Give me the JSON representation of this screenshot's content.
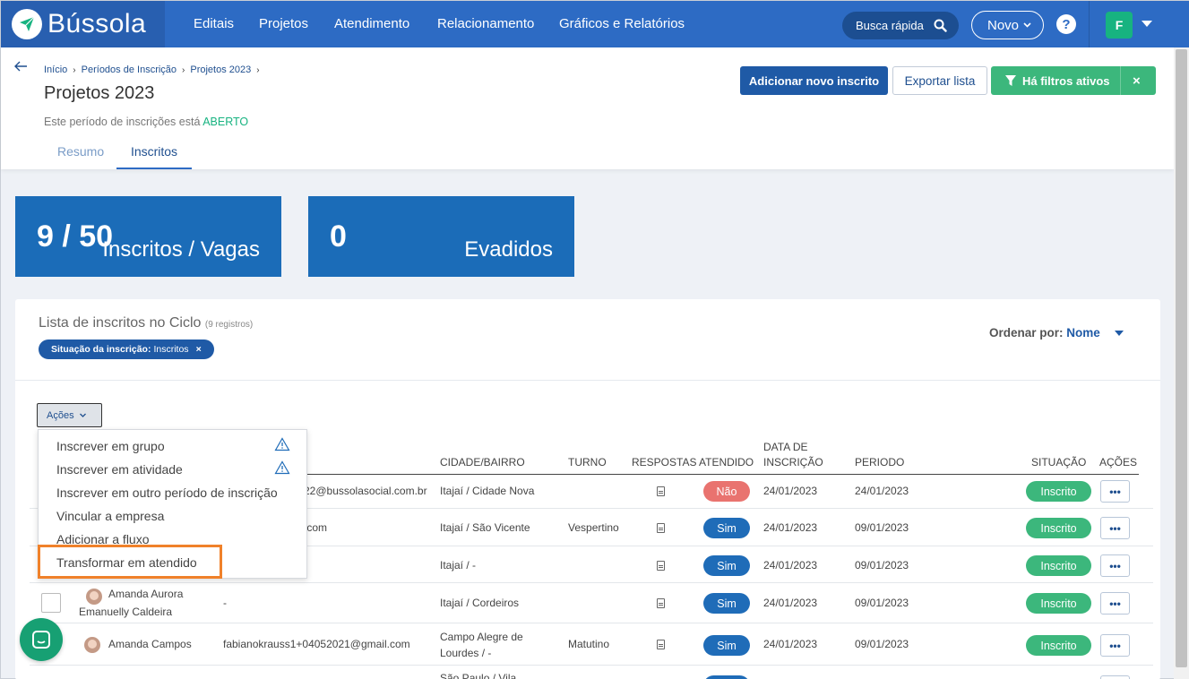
{
  "app": {
    "brand": "Bússola"
  },
  "nav": {
    "items": [
      "Editais",
      "Projetos",
      "Atendimento",
      "Relacionamento",
      "Gráficos e Relatórios"
    ],
    "search_label": "Busca rápida",
    "new_label": "Novo",
    "help": "?",
    "user_initial": "F"
  },
  "breadcrumb": [
    "Início",
    "Períodos de Inscrição",
    "Projetos 2023"
  ],
  "page": {
    "title": "Projetos 2023",
    "status_prefix": "Este período de inscrições está",
    "status_value": "ABERTO",
    "tabs": [
      "Resumo",
      "Inscritos"
    ],
    "active_tab": "Inscritos"
  },
  "actions": {
    "add_label": "Adicionar novo inscrito",
    "export_label": "Exportar lista",
    "filters_label": "Há filtros ativos",
    "close": "×"
  },
  "stats": [
    {
      "value": "9 / 50",
      "label": "Inscritos / Vagas"
    },
    {
      "value": "0",
      "label": "Evadidos"
    }
  ],
  "list": {
    "title": "Lista de inscritos no Ciclo",
    "count": "(9 registros)",
    "filter_chip_key": "Situação da inscrição:",
    "filter_chip_value": "Inscritos",
    "filter_chip_close": "×",
    "order_label": "Ordenar por:",
    "order_value": "Nome",
    "acoes_label": "Ações",
    "columns": {
      "cidade": "CIDADE/BAIRRO",
      "turno": "TURNO",
      "respostas": "RESPOSTAS",
      "atendido": "ATENDIDO",
      "data_l1": "DATA DE",
      "data_l2": "INSCRIÇÃO",
      "periodo": "PERIODO",
      "situacao": "SITUAÇÃO",
      "acoes": "AÇÕES"
    },
    "rows": [
      {
        "name": "",
        "email": "22@bussolasocial.com.br",
        "cidade": "Itajaí / Cidade Nova",
        "turno": "",
        "atendido": "Não",
        "data": "24/01/2023",
        "periodo": "24/01/2023",
        "situacao": "Inscrito"
      },
      {
        "name": "",
        "email": ".com",
        "cidade": "Itajaí / São Vicente",
        "turno": "Vespertino",
        "atendido": "Sim",
        "data": "24/01/2023",
        "periodo": "09/01/2023",
        "situacao": "Inscrito"
      },
      {
        "name": "",
        "email": "",
        "cidade": "Itajaí / -",
        "turno": "",
        "atendido": "Sim",
        "data": "24/01/2023",
        "periodo": "09/01/2023",
        "situacao": "Inscrito"
      },
      {
        "name_l1": "Amanda Aurora",
        "name_l2": "Emanuelly Caldeira",
        "email": "-",
        "cidade": "Itajaí / Cordeiros",
        "turno": "",
        "atendido": "Sim",
        "data": "24/01/2023",
        "periodo": "09/01/2023",
        "situacao": "Inscrito"
      },
      {
        "name": "Amanda Campos",
        "email": "fabianokrauss1+04052021@gmail.com",
        "cidade_l1": "Campo Alegre de",
        "cidade_l2": "Lourdes / -",
        "turno": "Matutino",
        "atendido": "Sim",
        "data": "24/01/2023",
        "periodo": "09/01/2023",
        "situacao": "Inscrito"
      },
      {
        "cidade_l1": "São Paulo / Vila"
      }
    ],
    "more": "•••"
  },
  "menu": {
    "items": [
      "Inscrever em grupo",
      "Inscrever em atividade",
      "Inscrever em outro período de inscrição",
      "Vincular a empresa",
      "Adicionar a fluxo",
      "Transformar em atendido"
    ]
  },
  "colors": {
    "primary": "#2d6bc4",
    "green": "#3cb77c",
    "highlight": "#f0812a",
    "red": "#e9736f"
  }
}
